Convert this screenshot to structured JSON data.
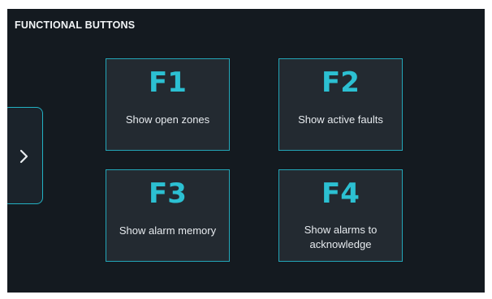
{
  "header": {
    "title": "FUNCTIONAL BUTTONS"
  },
  "side_toggle": {
    "icon": "chevron-right-icon"
  },
  "buttons": [
    {
      "key": "F1",
      "label": "Show open zones"
    },
    {
      "key": "F2",
      "label": "Show active faults"
    },
    {
      "key": "F3",
      "label": "Show alarm memory"
    },
    {
      "key": "F4",
      "label": "Show alarms to\nacknowledge"
    }
  ],
  "colors": {
    "background": "#141a20",
    "button_bg": "#232a31",
    "accent": "#2cc0d2",
    "border": "#23a6b8",
    "text": "#e6eaee"
  }
}
